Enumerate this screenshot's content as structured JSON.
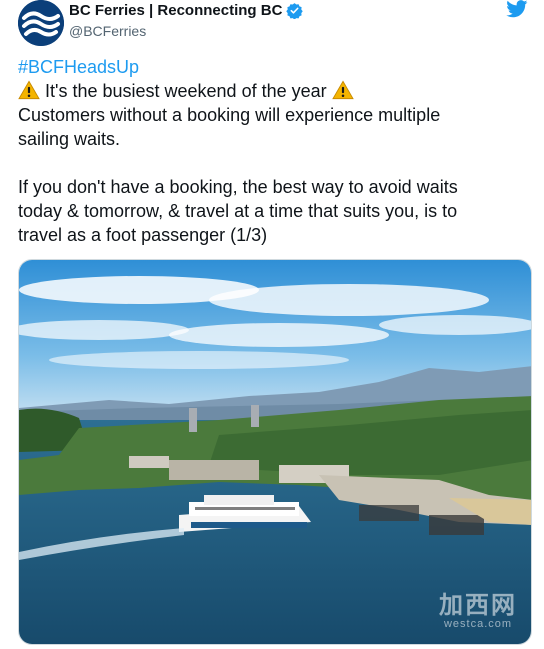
{
  "tweet": {
    "author": {
      "display_name": "BC Ferries | Reconnecting BC",
      "handle": "@BCFerries",
      "verified": true,
      "avatar_icon": "bc-ferries-waves-logo"
    },
    "platform_icon": "twitter-bird-icon",
    "hashtag": "#BCFHeadsUp",
    "headline": "It's the busiest weekend of the year",
    "headline_icon": "warning-icon",
    "line_2": "Customers without a booking will experience multiple",
    "line_3": "sailing waits.",
    "line_4": "If you don't have a booking, the best way to avoid waits",
    "line_5": "today & tomorrow, & travel at a time that suits you, is to",
    "line_6": "travel as a foot passenger (1/3)"
  },
  "media": {
    "description_icon": "ferry-terminal-photo",
    "watermark_logo": "加西网",
    "watermark_url": "westca.com"
  },
  "colors": {
    "link": "#1d9bf0",
    "brand_blue": "#0b3f7a",
    "verified": "#1d9bf0",
    "text": "#0f1419",
    "secondary": "#536471"
  }
}
